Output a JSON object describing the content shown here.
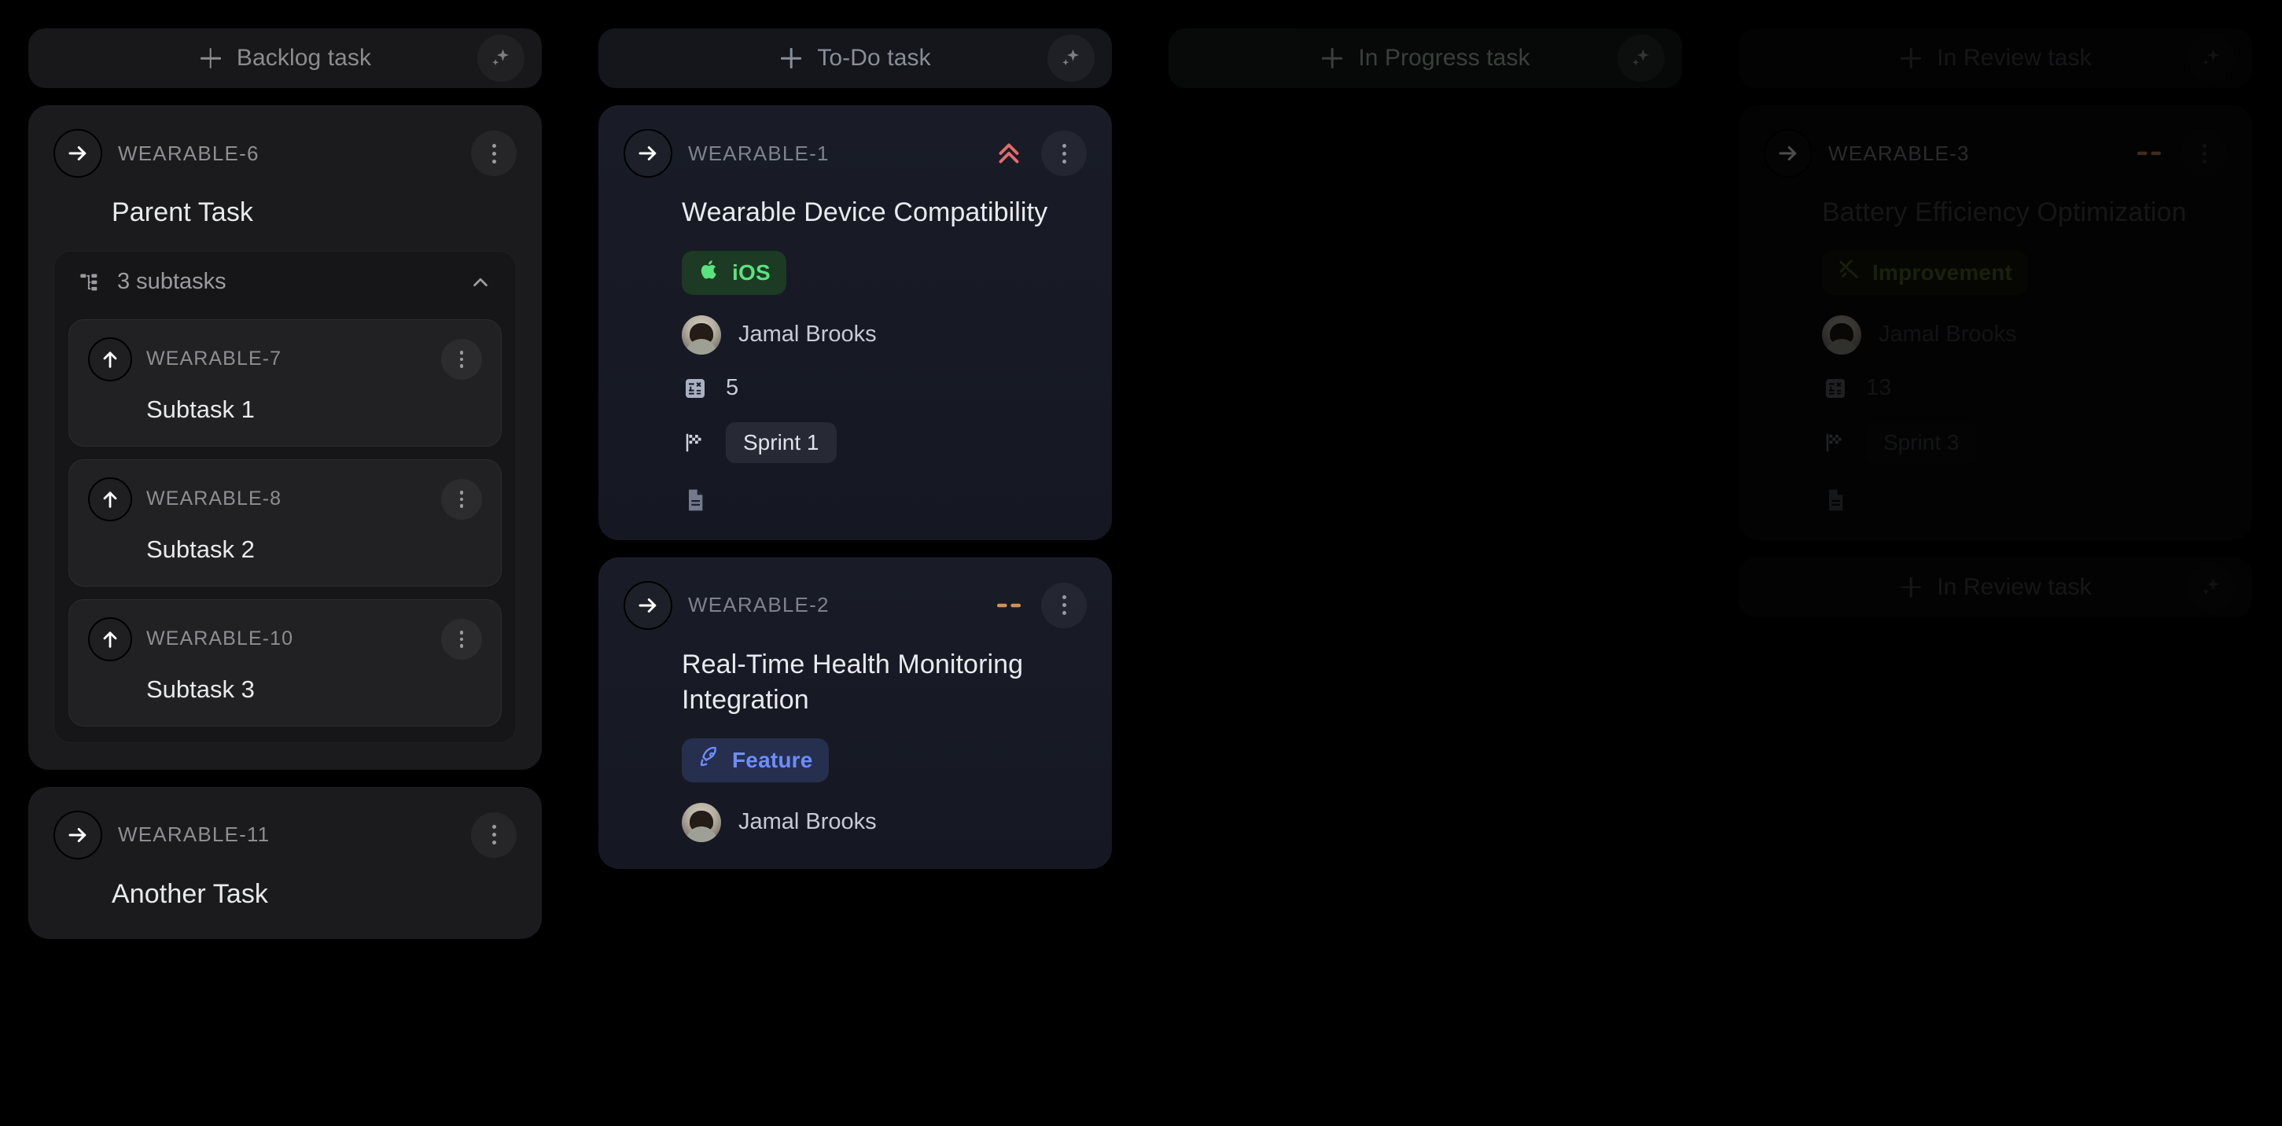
{
  "columns": [
    {
      "id": "backlog",
      "add_label": "Backlog task",
      "tint": "",
      "dim": "",
      "cards": [
        {
          "kind": "task",
          "type_icon": "arrow-right-icon",
          "ticket_id": "WEARABLE-6",
          "title": "Parent Task",
          "priority": "",
          "subtasks_summary": "3 subtasks",
          "subtasks": [
            {
              "type_icon": "arrow-up-icon",
              "ticket_id": "WEARABLE-7",
              "title": "Subtask 1"
            },
            {
              "type_icon": "arrow-up-icon",
              "ticket_id": "WEARABLE-8",
              "title": "Subtask 2"
            },
            {
              "type_icon": "arrow-up-icon",
              "ticket_id": "WEARABLE-10",
              "title": "Subtask 3"
            }
          ]
        },
        {
          "kind": "task",
          "type_icon": "arrow-right-icon",
          "ticket_id": "WEARABLE-11",
          "title": "Another Task",
          "priority": ""
        }
      ]
    },
    {
      "id": "todo",
      "add_label": "To-Do task",
      "tint": "tint-blue",
      "dim": "",
      "cards": [
        {
          "kind": "task",
          "type_icon": "arrow-right-icon",
          "ticket_id": "WEARABLE-1",
          "title": "Wearable Device Compatibility",
          "priority": "highest",
          "label": {
            "text": "iOS",
            "icon": "apple-icon",
            "color": "green"
          },
          "assignee": "Jamal Brooks",
          "estimate": "5",
          "sprint": "Sprint 1",
          "has_description": true
        },
        {
          "kind": "task",
          "type_icon": "arrow-right-icon",
          "ticket_id": "WEARABLE-2",
          "title": "Real-Time Health Monitoring Integration",
          "priority": "medium",
          "label": {
            "text": "Feature",
            "icon": "rocket-icon",
            "color": "blue"
          },
          "assignee": "Jamal Brooks"
        }
      ]
    },
    {
      "id": "inprogress",
      "add_label": "In Progress task",
      "tint": "tint-green",
      "dim": "dim-1",
      "cards": []
    },
    {
      "id": "inreview",
      "add_label": "In Review task",
      "tint": "tint-dark",
      "dim": "dim-2",
      "add_label_bottom": "In Review task",
      "cards": [
        {
          "kind": "task",
          "type_icon": "arrow-right-icon",
          "ticket_id": "WEARABLE-3",
          "title": "Battery Efficiency Optimization",
          "priority": "medium",
          "label": {
            "text": "Improvement",
            "icon": "tools-icon",
            "color": "olive"
          },
          "assignee": "Jamal Brooks",
          "estimate": "13",
          "sprint": "Sprint 3",
          "has_description": true
        }
      ]
    }
  ],
  "icons": {
    "sparkle": "sparkle-icon",
    "plus": "plus-icon",
    "kebab": "more-vertical-icon",
    "chevron_up": "chevron-up-icon",
    "subtasks": "subtasks-tree-icon",
    "estimate": "estimate-calculator-icon",
    "sprint": "checkered-flag-icon",
    "description": "description-document-icon"
  },
  "colors": {
    "background": "#000000",
    "card": "#1b1b1d",
    "card_navy": "#171a24",
    "priority_highest": "#e06c6c",
    "priority_medium": "#d49155",
    "label_green_bg": "#1c3a24",
    "label_green_fg": "#5ae27e",
    "label_blue_bg": "#262f4d",
    "label_blue_fg": "#6e8dfb",
    "label_olive_bg": "#14180c",
    "label_olive_fg": "#5b6e1f",
    "muted_text": "#8d8d93",
    "title_text": "#e9eaee"
  }
}
